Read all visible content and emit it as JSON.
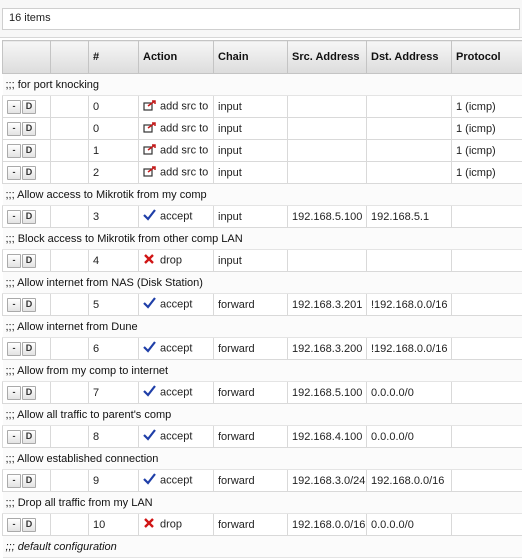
{
  "header": {
    "count_label": "16 items"
  },
  "columns": [
    "",
    "",
    "#",
    "Action",
    "Chain",
    "Src. Address",
    "Dst. Address",
    "Protocol"
  ],
  "buttons": {
    "minus": "-",
    "disable": "D"
  },
  "rows": [
    {
      "type": "comment",
      "text": ";;; for port knocking"
    },
    {
      "type": "rule",
      "num": "0",
      "action": "add src to",
      "action_icon": "add-src-list-icon",
      "chain": "input",
      "src": "",
      "dst": "",
      "proto": "1 (icmp)"
    },
    {
      "type": "rule",
      "num": "0",
      "action": "add src to",
      "action_icon": "add-src-list-icon",
      "chain": "input",
      "src": "",
      "dst": "",
      "proto": "1 (icmp)"
    },
    {
      "type": "rule",
      "num": "1",
      "action": "add src to",
      "action_icon": "add-src-list-icon",
      "chain": "input",
      "src": "",
      "dst": "",
      "proto": "1 (icmp)"
    },
    {
      "type": "rule",
      "num": "2",
      "action": "add src to",
      "action_icon": "add-src-list-icon",
      "chain": "input",
      "src": "",
      "dst": "",
      "proto": "1 (icmp)"
    },
    {
      "type": "comment",
      "text": ";;; Allow access to Mikrotik from my comp"
    },
    {
      "type": "rule",
      "num": "3",
      "action": "accept",
      "action_icon": "accept-check-icon",
      "chain": "input",
      "src": "192.168.5.100",
      "dst": "192.168.5.1",
      "proto": ""
    },
    {
      "type": "comment",
      "text": ";;; Block access to Mikrotik from other comp LAN"
    },
    {
      "type": "rule",
      "num": "4",
      "action": "drop",
      "action_icon": "drop-x-icon",
      "chain": "input",
      "src": "",
      "dst": "",
      "proto": ""
    },
    {
      "type": "comment",
      "text": ";;; Allow internet from NAS (Disk Station)"
    },
    {
      "type": "rule",
      "num": "5",
      "action": "accept",
      "action_icon": "accept-check-icon",
      "chain": "forward",
      "src": "192.168.3.201",
      "dst": "!192.168.0.0/16",
      "proto": ""
    },
    {
      "type": "comment",
      "text": ";;; Allow internet from Dune"
    },
    {
      "type": "rule",
      "num": "6",
      "action": "accept",
      "action_icon": "accept-check-icon",
      "chain": "forward",
      "src": "192.168.3.200",
      "dst": "!192.168.0.0/16",
      "proto": ""
    },
    {
      "type": "comment",
      "text": ";;; Allow from my comp to internet"
    },
    {
      "type": "rule",
      "num": "7",
      "action": "accept",
      "action_icon": "accept-check-icon",
      "chain": "forward",
      "src": "192.168.5.100",
      "dst": "0.0.0.0/0",
      "proto": ""
    },
    {
      "type": "comment",
      "text": ";;; Allow all traffic to parent's comp"
    },
    {
      "type": "rule",
      "num": "8",
      "action": "accept",
      "action_icon": "accept-check-icon",
      "chain": "forward",
      "src": "192.168.4.100",
      "dst": "0.0.0.0/0",
      "proto": ""
    },
    {
      "type": "comment",
      "text": ";;; Allow established connection"
    },
    {
      "type": "rule",
      "num": "9",
      "action": "accept",
      "action_icon": "accept-check-icon",
      "chain": "forward",
      "src": "192.168.3.0/24",
      "dst": "192.168.0.0/16",
      "proto": ""
    },
    {
      "type": "comment",
      "text": ";;; Drop all traffic from my LAN"
    },
    {
      "type": "rule",
      "num": "10",
      "action": "drop",
      "action_icon": "drop-x-icon",
      "chain": "forward",
      "src": "192.168.0.0/16",
      "dst": "0.0.0.0/0",
      "proto": ""
    },
    {
      "type": "comment",
      "text": ";;; default configuration",
      "faded": true
    }
  ],
  "colors": {
    "accept": "#1f3fa8",
    "drop": "#d01515",
    "add": "#c41a1a"
  }
}
